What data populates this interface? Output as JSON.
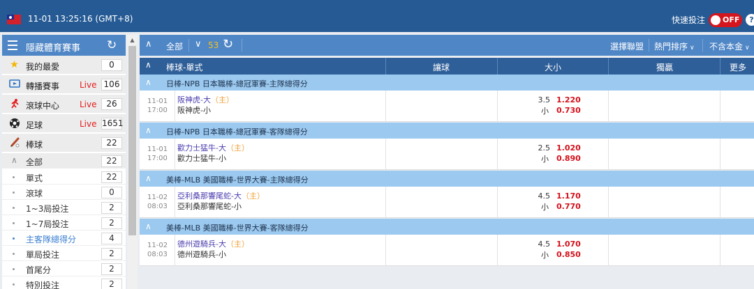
{
  "header": {
    "datetime": "11-01 13:25:16 (GMT+8)",
    "quick_bet_label": "快速投注",
    "toggle_state": "OFF",
    "help_label": "?",
    "accent_color": "#255a94",
    "toggle_color": "#d5151d"
  },
  "sidebar": {
    "title": "隱藏體育賽事",
    "sections": [
      {
        "label": "我的最愛",
        "icon": "star-icon",
        "live": "",
        "count": "0"
      },
      {
        "label": "轉播賽事",
        "icon": "tv-icon",
        "live": "Live",
        "count": "106"
      },
      {
        "label": "滾球中心",
        "icon": "runner-icon",
        "live": "Live",
        "count": "26"
      },
      {
        "label": "足球",
        "icon": "soccer-ball-icon",
        "live": "Live",
        "count": "1651"
      },
      {
        "label": "棒球",
        "icon": "baseball-bat-icon",
        "live": "",
        "count": "22"
      }
    ],
    "sub_all": {
      "label": "全部",
      "count": "22"
    },
    "sub_items": [
      {
        "label": "單式",
        "count": "22"
      },
      {
        "label": "滾球",
        "count": "0"
      },
      {
        "label": "1~3局投注",
        "count": "2"
      },
      {
        "label": "1~7局投注",
        "count": "2"
      },
      {
        "label": "主客隊總得分",
        "count": "4",
        "active": true
      },
      {
        "label": "單局投注",
        "count": "2"
      },
      {
        "label": "首尾分",
        "count": "2"
      },
      {
        "label": "特別投注",
        "count": "2"
      }
    ]
  },
  "toolbar": {
    "all_label": "全部",
    "count": "53",
    "select_league": "選擇聯盟",
    "sort_label": "熱門排序",
    "currency_label": "不含本金"
  },
  "table_header": {
    "col1": "棒球-單式",
    "col2": "讓球",
    "col3": "大小",
    "col4": "獨贏",
    "col5": "更多"
  },
  "groups": [
    {
      "league": "日棒-NPB 日本職棒-總冠軍賽-主隊總得分",
      "date": "11-01",
      "time": "17:00",
      "team1": "阪神虎-大",
      "host": "（主）",
      "team2": "阪神虎-小",
      "line": "3.5",
      "over_odds": "1.220",
      "under_label": "小",
      "under_odds": "0.730"
    },
    {
      "league": "日棒-NPB 日本職棒-總冠軍賽-客隊總得分",
      "date": "11-01",
      "time": "17:00",
      "team1": "歡力士猛牛-大",
      "host": "（主）",
      "team2": "歡力士猛牛-小",
      "line": "2.5",
      "over_odds": "1.020",
      "under_label": "小",
      "under_odds": "0.890"
    },
    {
      "league": "美棒-MLB 美國職棒-世界大賽-主隊總得分",
      "date": "11-02",
      "time": "08:03",
      "team1": "亞利桑那響尾蛇-大",
      "host": "（主）",
      "team2": "亞利桑那響尾蛇-小",
      "line": "4.5",
      "over_odds": "1.170",
      "under_label": "小",
      "under_odds": "0.770"
    },
    {
      "league": "美棒-MLB 美國職棒-世界大賽-客隊總得分",
      "date": "11-02",
      "time": "08:03",
      "team1": "德州遊騎兵-大",
      "host": "（主）",
      "team2": "德州遊騎兵-小",
      "line": "4.5",
      "over_odds": "1.070",
      "under_label": "小",
      "under_odds": "0.850"
    }
  ]
}
